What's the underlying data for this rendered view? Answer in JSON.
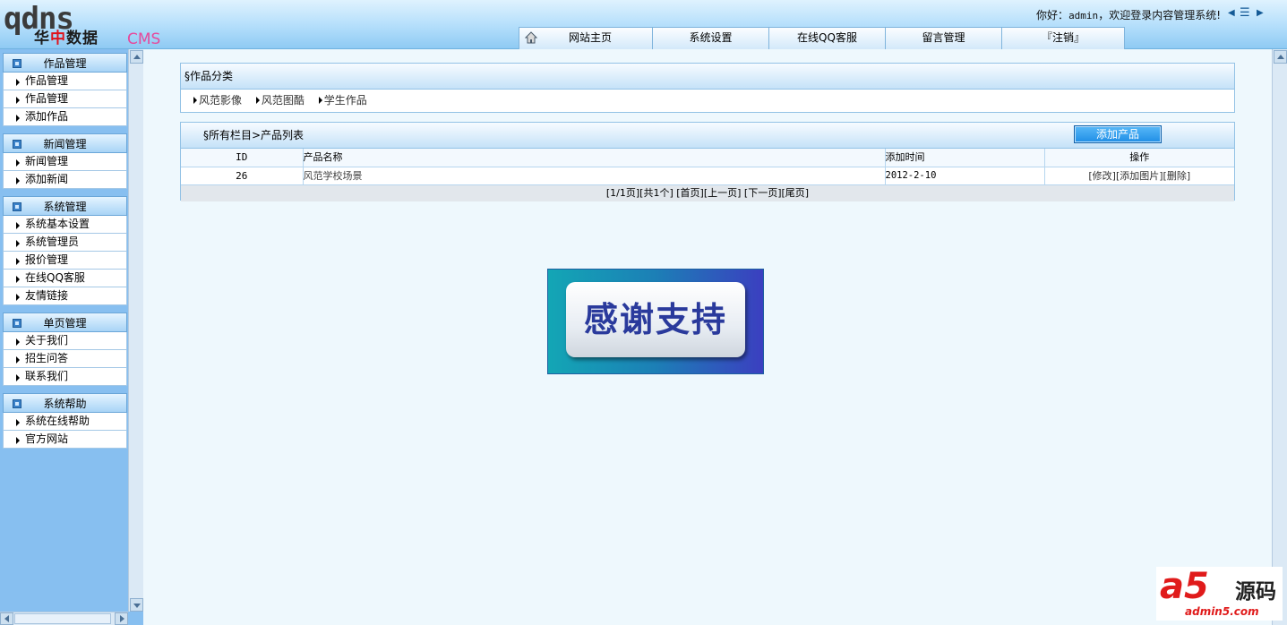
{
  "header": {
    "logo_big": "qdns",
    "logo_cn_left": "华",
    "logo_cn_mid": "中",
    "logo_cn_right": "数据",
    "logo_cms": "CMS",
    "welcome_prefix": "你好：",
    "welcome_user": "admin",
    "welcome_suffix": "，欢迎登录内容管理系统!",
    "tabs": [
      "网站主页",
      "系统设置",
      "在线QQ客服",
      "留言管理",
      "『注销』"
    ]
  },
  "sidebar": {
    "sections": [
      {
        "title": "作品管理",
        "items": [
          "作品管理",
          "作品管理",
          "添加作品"
        ]
      },
      {
        "title": "新闻管理",
        "items": [
          "新闻管理",
          "添加新闻"
        ]
      },
      {
        "title": "系统管理",
        "items": [
          "系统基本设置",
          "系统管理员",
          "报价管理",
          "在线QQ客服",
          "友情链接"
        ]
      },
      {
        "title": "单页管理",
        "items": [
          "关于我们",
          "招生问答",
          "联系我们"
        ]
      },
      {
        "title": "系统帮助",
        "items": [
          "系统在线帮助",
          "官方网站"
        ]
      }
    ]
  },
  "category": {
    "title": "§作品分类",
    "links": [
      "风范影像",
      "风范图酷",
      "学生作品"
    ]
  },
  "list": {
    "title": "§所有栏目>产品列表",
    "add_button": "添加产品",
    "columns": [
      "ID",
      "产品名称",
      "添加时间",
      "操作"
    ],
    "rows": [
      {
        "id": "26",
        "name": "风范学校场景",
        "time": "2012-2-10",
        "ops": [
          "[修改]",
          "[添加图片]",
          "[删除]"
        ]
      }
    ],
    "pager": "[1/1页][共1个] [首页][上一页] [下一页][尾页]"
  },
  "banner": {
    "text": "感谢支持"
  },
  "watermark": {
    "brand": "a5",
    "brand_cn": "源码",
    "domain": "admin5.com"
  },
  "colors": {
    "header_bg": "#b3defb",
    "sidebar_bg": "#87bff0",
    "button_blue": "#1f8ee6",
    "main_bg": "#eef8fd"
  }
}
